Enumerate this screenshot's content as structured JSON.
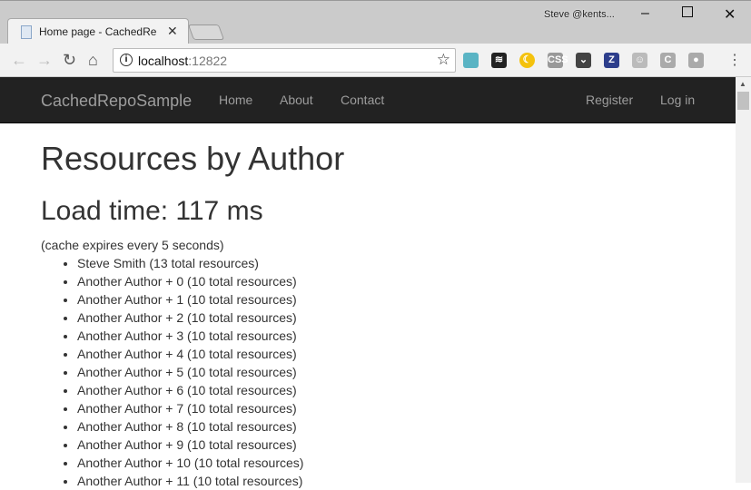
{
  "browser": {
    "tab_title": "Home page - CachedRep",
    "profile": "Steve @kents...",
    "url_host": "localhost",
    "url_port": ":12822",
    "extensions": [
      {
        "name": "octopus-icon",
        "color": "#5ab4c4",
        "label": ""
      },
      {
        "name": "buffer-icon",
        "color": "#222222",
        "label": "≋"
      },
      {
        "name": "moon-icon",
        "color": "#f4c20d",
        "label": "☾"
      },
      {
        "name": "css-icon",
        "color": "#999999",
        "label": "CSS"
      },
      {
        "name": "pocket-icon",
        "color": "#444444",
        "label": "⌄"
      },
      {
        "name": "z-icon",
        "color": "#2d3e8c",
        "label": "Z"
      },
      {
        "name": "face-icon",
        "color": "#bbbbbb",
        "label": "☺"
      },
      {
        "name": "c-icon",
        "color": "#aaaaaa",
        "label": "C"
      },
      {
        "name": "lock-icon",
        "color": "#aaaaaa",
        "label": "●"
      }
    ]
  },
  "navbar": {
    "brand": "CachedRepoSample",
    "links": [
      "Home",
      "About",
      "Contact"
    ],
    "right_links": [
      "Register",
      "Log in"
    ]
  },
  "main": {
    "title": "Resources by Author",
    "load_time": "Load time: 117 ms",
    "note": "(cache expires every 5 seconds)",
    "items": [
      "Steve Smith (13 total resources)",
      "Another Author + 0 (10 total resources)",
      "Another Author + 1 (10 total resources)",
      "Another Author + 2 (10 total resources)",
      "Another Author + 3 (10 total resources)",
      "Another Author + 4 (10 total resources)",
      "Another Author + 5 (10 total resources)",
      "Another Author + 6 (10 total resources)",
      "Another Author + 7 (10 total resources)",
      "Another Author + 8 (10 total resources)",
      "Another Author + 9 (10 total resources)",
      "Another Author + 10 (10 total resources)",
      "Another Author + 11 (10 total resources)"
    ]
  }
}
